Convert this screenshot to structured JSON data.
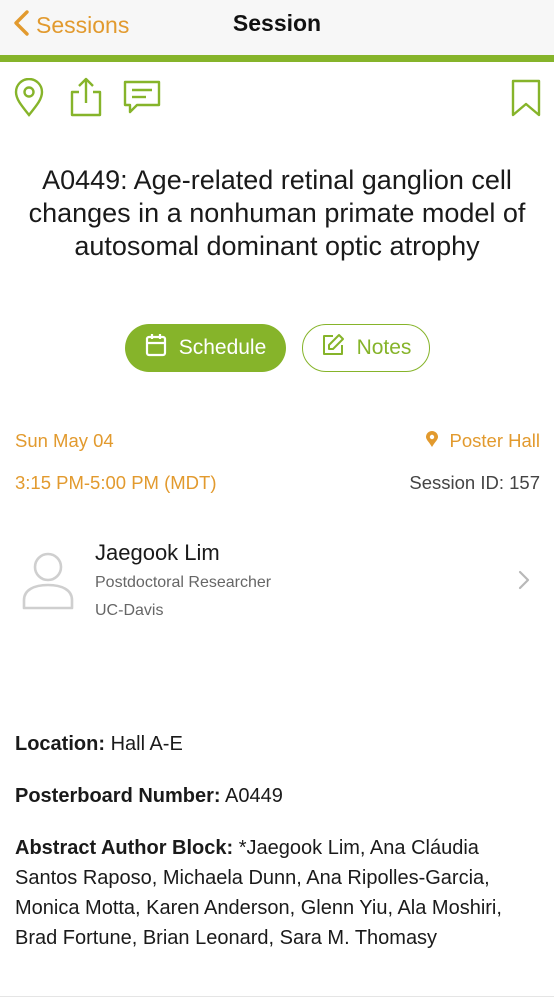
{
  "nav": {
    "back_label": "Sessions",
    "title": "Session"
  },
  "colors": {
    "accent_green": "#86b42a",
    "accent_orange": "#e29a2e"
  },
  "toolbar_icons": [
    "map-pin-icon",
    "share-icon",
    "chat-icon",
    "bookmark-icon"
  ],
  "session": {
    "title": "A0449: Age-related retinal ganglion cell changes in a nonhuman primate model of autosomal dominant optic atrophy",
    "schedule_label": "Schedule",
    "notes_label": "Notes",
    "date": "Sun May 04",
    "place": "Poster Hall",
    "time": "3:15 PM-5:00 PM (MDT)",
    "session_id": "Session ID: 157"
  },
  "speaker": {
    "name": "Jaegook Lim",
    "role": "Postdoctoral Researcher",
    "organization": "UC-Davis"
  },
  "details": {
    "location_label": "Location:",
    "location_value": "Hall A-E",
    "posterboard_label": "Posterboard Number:",
    "posterboard_value": "A0449",
    "authors_label": "Abstract Author Block:",
    "authors_value": "*Jaegook Lim, Ana Cláudia Santos Raposo, Michaela Dunn, Ana Ripolles-Garcia, Monica Motta, Karen Anderson, Glenn Yiu, Ala Moshiri, Brad Fortune, Brian Leonard, Sara M. Thomasy"
  }
}
